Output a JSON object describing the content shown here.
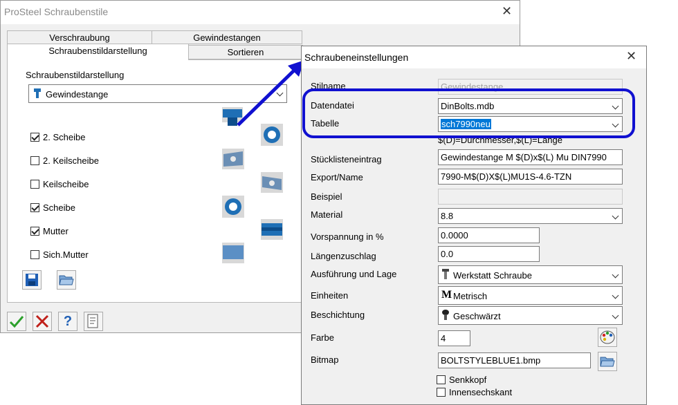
{
  "main_window": {
    "title": "ProSteel Schraubenstile",
    "tabs": [
      "Verschraubung",
      "Gewindestangen",
      "Schraubenstildarstellung",
      "Sortieren"
    ],
    "group_label": "Schraubenstildarstellung",
    "style_select": "Gewindestange",
    "checkboxes": [
      {
        "label": "2. Scheibe",
        "checked": true
      },
      {
        "label": "2. Keilscheibe",
        "checked": false
      },
      {
        "label": "Keilscheibe",
        "checked": false
      },
      {
        "label": "Scheibe",
        "checked": true
      },
      {
        "label": "Mutter",
        "checked": true
      },
      {
        "label": "Sich.Mutter",
        "checked": false
      }
    ]
  },
  "dialog": {
    "title": "Schraubeneinstellungen",
    "stilname": {
      "label": "Stilname",
      "value": "Gewindestange"
    },
    "datendatei": {
      "label": "Datendatei",
      "value": "DinBolts.mdb"
    },
    "tabelle": {
      "label": "Tabelle",
      "value": "sch7990neu"
    },
    "hint": "$(D)=Durchmesser,$(L)=Länge",
    "stueckliste": {
      "label": "Stücklisteneintrag",
      "value": "Gewindestange M $(D)x$(L) Mu DIN7990"
    },
    "export": {
      "label": "Export/Name",
      "value": "7990-M$(D)X$(L)MU1S-4.6-TZN"
    },
    "beispiel": {
      "label": "Beispiel",
      "value": ""
    },
    "material": {
      "label": "Material",
      "value": "8.8"
    },
    "vorspannung": {
      "label": "Vorspannung in %",
      "value": "0.0000"
    },
    "laengenzuschlag": {
      "label": "Längenzuschlag",
      "value": "0.0"
    },
    "ausfuehrung": {
      "label": "Ausführung und Lage",
      "value": "Werkstatt Schraube"
    },
    "einheiten": {
      "label": "Einheiten",
      "value": "Metrisch",
      "icon_glyph": "M"
    },
    "beschichtung": {
      "label": "Beschichtung",
      "value": "Geschwärzt"
    },
    "farbe": {
      "label": "Farbe",
      "value": "4"
    },
    "bitmap": {
      "label": "Bitmap",
      "value": "BOLTSTYLEBLUE1.bmp"
    },
    "senkkopf": {
      "label": "Senkkopf",
      "checked": false
    },
    "innensechskant": {
      "label": "Innensechskant",
      "checked": false
    }
  },
  "colors": {
    "accent": "#0078d7",
    "highlight": "#1010d0",
    "bolt_blue": "#1f6fb5",
    "bolt_dark": "#0d4d8a"
  },
  "icons": [
    "bolt-icon",
    "save-icon",
    "folder-open-icon",
    "ok-icon",
    "cancel-icon",
    "help-icon",
    "report-icon",
    "palette-icon",
    "tool-icon",
    "coating-icon"
  ]
}
